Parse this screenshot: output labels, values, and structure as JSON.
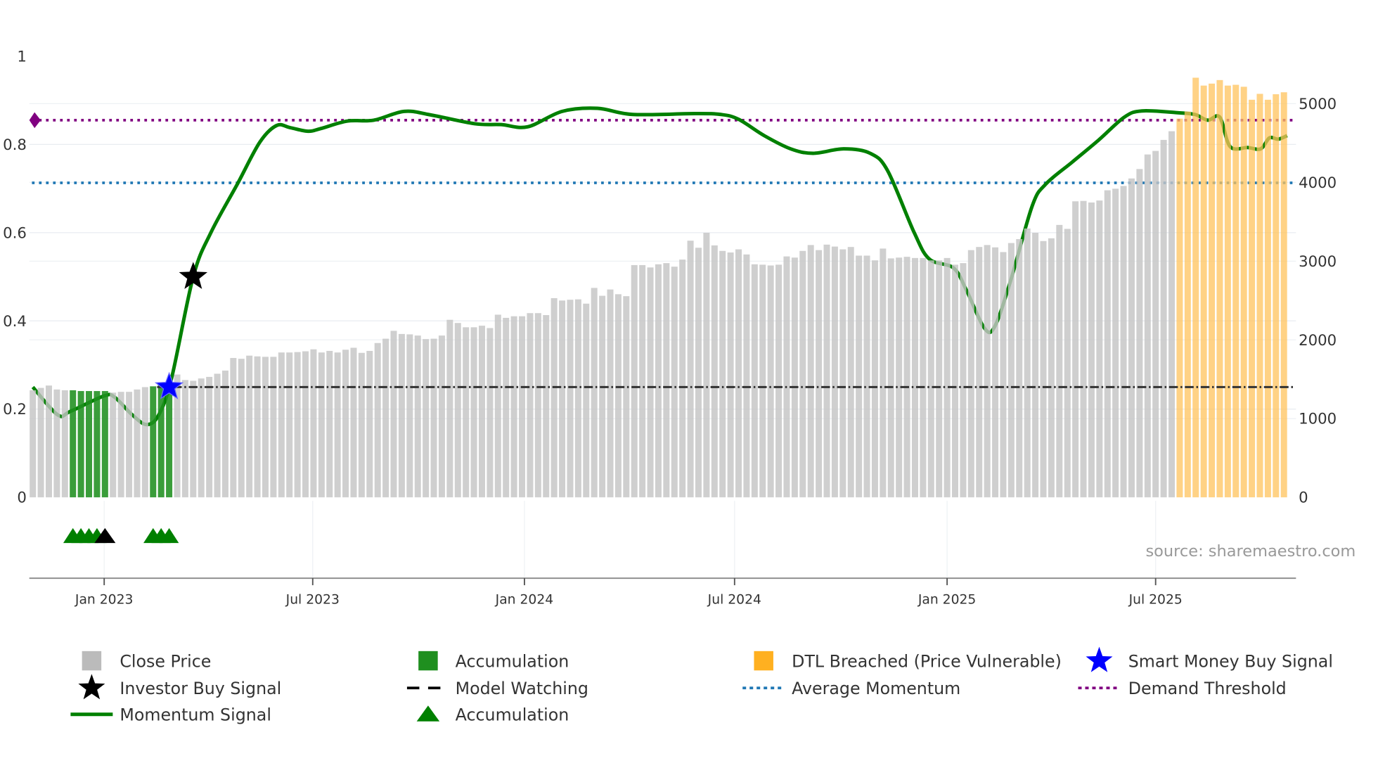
{
  "chart_data": {
    "type": "bar",
    "title": "",
    "xlabel": "",
    "ylabel_left": "",
    "ylabel_right": "",
    "source": "source: sharemaestro.com",
    "left_axis": {
      "range": [
        0,
        1
      ],
      "ticks": [
        "0",
        "0.2",
        "0.4",
        "0.6",
        "0.8",
        "1"
      ],
      "tick_values": [
        0,
        0.2,
        0.4,
        0.6,
        0.8,
        1
      ]
    },
    "right_axis": {
      "range": [
        0,
        5600
      ],
      "ticks": [
        "0",
        "1000",
        "2000",
        "3000",
        "4000",
        "5000"
      ],
      "tick_values": [
        0,
        1000,
        2000,
        3000,
        4000,
        5000
      ]
    },
    "x_axis": {
      "unit": "week index",
      "range": [
        0,
        156
      ],
      "ticks": [
        "Jan 2023",
        "Jul 2023",
        "Jan 2024",
        "Jul 2024",
        "Jan 2025",
        "Jul 2025"
      ],
      "tick_positions": [
        8.9,
        34.9,
        61.3,
        87.5,
        114,
        140
      ]
    },
    "close_price": [
      1360,
      1390,
      1420,
      1370,
      1360,
      1360,
      1350,
      1350,
      1350,
      1350,
      1330,
      1340,
      1340,
      1370,
      1400,
      1410,
      1440,
      1450,
      1560,
      1490,
      1480,
      1510,
      1530,
      1570,
      1610,
      1770,
      1760,
      1800,
      1790,
      1785,
      1785,
      1840,
      1840,
      1845,
      1855,
      1880,
      1840,
      1860,
      1840,
      1875,
      1900,
      1835,
      1860,
      1960,
      2015,
      2115,
      2075,
      2070,
      2055,
      2010,
      2015,
      2055,
      2255,
      2215,
      2160,
      2160,
      2180,
      2150,
      2320,
      2280,
      2300,
      2300,
      2340,
      2340,
      2315,
      2530,
      2500,
      2510,
      2515,
      2460,
      2660,
      2560,
      2640,
      2580,
      2555,
      2950,
      2950,
      2920,
      2960,
      2975,
      2930,
      3020,
      3260,
      3170,
      3360,
      3200,
      3130,
      3110,
      3150,
      3085,
      2960,
      2955,
      2945,
      2955,
      3060,
      3045,
      3130,
      3205,
      3140,
      3210,
      3185,
      3150,
      3180,
      3070,
      3070,
      3010,
      3160,
      3035,
      3045,
      3055,
      3040,
      3040,
      3010,
      3010,
      3040,
      2955,
      2975,
      3140,
      3180,
      3205,
      3175,
      3115,
      3230,
      3280,
      3415,
      3360,
      3255,
      3290,
      3460,
      3410,
      3760,
      3765,
      3745,
      3770,
      3900,
      3920,
      3955,
      4050,
      4170,
      4355,
      4400,
      4540,
      4650,
      4810,
      4900,
      5330,
      5230,
      5255,
      5300,
      5230,
      5240,
      5215,
      5050,
      5125,
      5050,
      5120,
      5145
    ],
    "accumulation_bars": [
      5,
      6,
      7,
      8,
      9,
      15,
      16,
      17
    ],
    "dtl_breached_from": 143,
    "momentum_signal": [
      [
        0,
        0.25
      ],
      [
        3.1,
        0.187
      ],
      [
        4.7,
        0.195
      ],
      [
        8.9,
        0.23
      ],
      [
        10.2,
        0.227
      ],
      [
        12.4,
        0.187
      ],
      [
        14.2,
        0.165
      ],
      [
        15.7,
        0.187
      ],
      [
        17.3,
        0.27
      ],
      [
        20,
        0.5
      ],
      [
        22.2,
        0.6
      ],
      [
        25.5,
        0.71
      ],
      [
        28.3,
        0.805
      ],
      [
        30.4,
        0.843
      ],
      [
        32.1,
        0.838
      ],
      [
        34.3,
        0.83
      ],
      [
        35.9,
        0.836
      ],
      [
        39.2,
        0.853
      ],
      [
        42.5,
        0.855
      ],
      [
        46.3,
        0.875
      ],
      [
        49.6,
        0.867
      ],
      [
        55.1,
        0.847
      ],
      [
        58.4,
        0.845
      ],
      [
        61.7,
        0.84
      ],
      [
        66,
        0.875
      ],
      [
        70.4,
        0.882
      ],
      [
        74.8,
        0.868
      ],
      [
        82.5,
        0.87
      ],
      [
        85.8,
        0.868
      ],
      [
        88,
        0.857
      ],
      [
        91.2,
        0.82
      ],
      [
        94.5,
        0.79
      ],
      [
        97.3,
        0.78
      ],
      [
        101.1,
        0.79
      ],
      [
        104.4,
        0.78
      ],
      [
        106.6,
        0.74
      ],
      [
        109.9,
        0.6
      ],
      [
        111.8,
        0.54
      ],
      [
        114.8,
        0.52
      ],
      [
        116.4,
        0.47
      ],
      [
        118.6,
        0.385
      ],
      [
        119.9,
        0.386
      ],
      [
        121.9,
        0.49
      ],
      [
        124.6,
        0.66
      ],
      [
        126.3,
        0.71
      ],
      [
        129.6,
        0.76
      ],
      [
        132.9,
        0.81
      ],
      [
        136.1,
        0.862
      ],
      [
        138.3,
        0.876
      ],
      [
        142.7,
        0.872
      ],
      [
        144.9,
        0.868
      ],
      [
        146.5,
        0.855
      ],
      [
        148,
        0.862
      ],
      [
        149.3,
        0.795
      ],
      [
        151.5,
        0.793
      ],
      [
        153.1,
        0.79
      ],
      [
        154.2,
        0.815
      ],
      [
        155.3,
        0.812
      ],
      [
        156.4,
        0.82
      ]
    ],
    "model_watching": {
      "value": 0.25,
      "from": 15.5
    },
    "average_momentum": 0.713,
    "demand_threshold": 0.855,
    "investor_buy_signals": [
      [
        20,
        0.5
      ]
    ],
    "smart_money_buy_signals": [
      [
        17,
        0.25
      ]
    ],
    "accumulation_markers": [
      5,
      6,
      7,
      8,
      15,
      16,
      17
    ],
    "watch_markers": [
      9
    ],
    "colors": {
      "close": "#c4c4c4",
      "accumulation": "#1f8f1f",
      "dtl": "#ffc35c",
      "momentum": "#008000",
      "avg": "#1f77b4",
      "demand": "#800080",
      "smart": "#0000ff"
    },
    "legend": [
      {
        "label": "Close Price",
        "icon": "gray-square"
      },
      {
        "label": "Accumulation",
        "icon": "green-square"
      },
      {
        "label": "DTL Breached (Price Vulnerable)",
        "icon": "orange-square"
      },
      {
        "label": "Smart Money Buy Signal",
        "icon": "blue-star"
      },
      {
        "label": "Investor Buy Signal",
        "icon": "black-star"
      },
      {
        "label": "Model Watching",
        "icon": "black-dash"
      },
      {
        "label": "Average Momentum",
        "icon": "blue-dot-line"
      },
      {
        "label": "Demand Threshold",
        "icon": "purple-dot-line"
      },
      {
        "label": "Momentum Signal",
        "icon": "green-line"
      },
      {
        "label": "Accumulation",
        "icon": "green-triangle"
      }
    ]
  }
}
